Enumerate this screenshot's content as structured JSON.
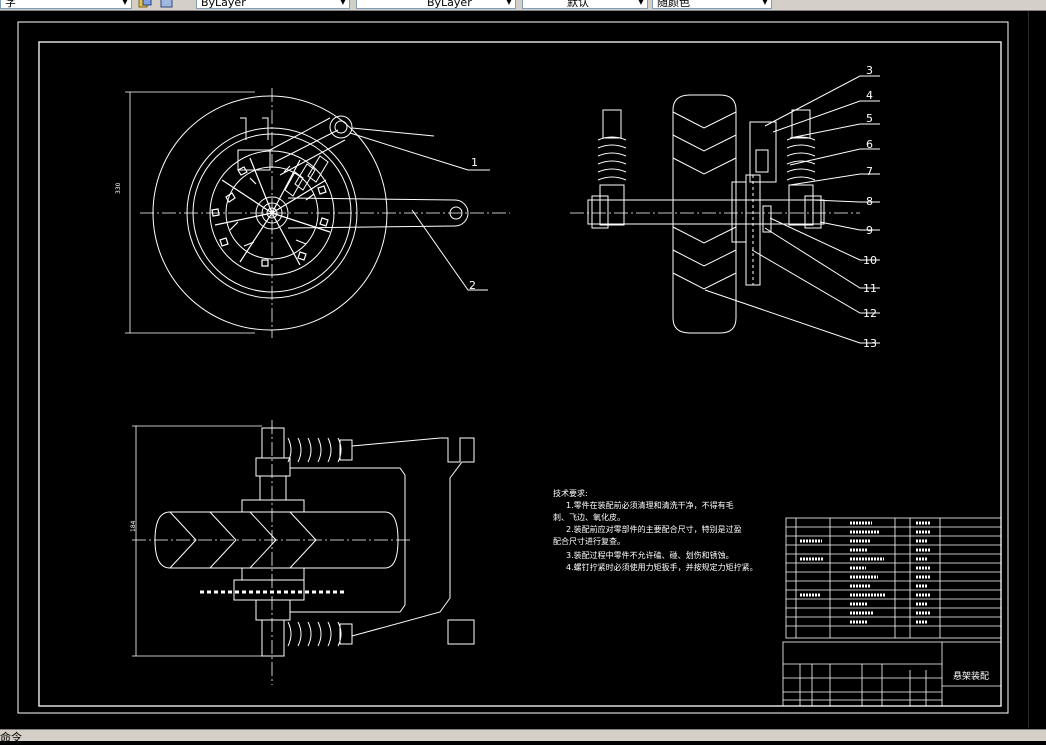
{
  "toolbar": {
    "cut_left_label": "字",
    "linetype_value": "ByLayer",
    "lineweight_value": "ByLayer",
    "plotstyle_value": "默认",
    "color_value": "随颜色"
  },
  "drawing": {
    "balloons": [
      "1",
      "2",
      "3",
      "4",
      "5",
      "6",
      "7",
      "8",
      "9",
      "10",
      "11",
      "12",
      "13"
    ],
    "dim_diameter": "330",
    "dim_height": "184",
    "notes_title": "技术要求:",
    "notes": [
      "1.零件在装配前必须清理和清洗干净，不得有毛",
      "刺、飞边、氧化皮。",
      "2.装配前应对零部件的主要配合尺寸，特别是过盈",
      "配合尺寸进行复查。",
      "3.装配过程中零件不允许磕、碰、划伤和锈蚀。",
      "4.螺钉拧紧时必须使用力矩扳手，并按规定力矩拧紧。"
    ],
    "title_block_name": "悬架装配"
  },
  "status": {
    "bottom_text": "命令"
  },
  "colors": {
    "canvas": "#000000",
    "lines": "#ffffff",
    "toolbar": "#d4d0c8"
  }
}
